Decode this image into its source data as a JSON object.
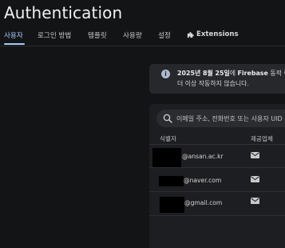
{
  "header": {
    "title": "Authentication"
  },
  "tabs": [
    {
      "label": "사용자",
      "active": true
    },
    {
      "label": "로그인 방법",
      "active": false
    },
    {
      "label": "템플릿",
      "active": false
    },
    {
      "label": "사용량",
      "active": false
    },
    {
      "label": "설정",
      "active": false
    },
    {
      "label": "Extensions",
      "active": false,
      "icon": "extension-icon"
    }
  ],
  "banner": {
    "icon": "info-icon",
    "line1_prefix": "2025년 8월 25일",
    "line1_mid": "에 ",
    "line1_product": "Firebase",
    "line1_suffix": " 동적 링크",
    "line2": "더 이상 작동하지 않습니다."
  },
  "search": {
    "icon": "search-icon",
    "placeholder": "이메일 주소, 전화번호 또는 사용자 UID"
  },
  "table": {
    "columns": [
      "식별자",
      "제공업체"
    ],
    "rows": [
      {
        "identifier": "@ansan.ac.kr",
        "provider_icon": "mail-icon"
      },
      {
        "identifier": "@naver.com",
        "provider_icon": "mail-icon"
      },
      {
        "identifier": "@gmail.com",
        "provider_icon": "mail-icon"
      }
    ]
  },
  "colors": {
    "background": "#131416",
    "accent": "#a8c7fa",
    "panel": "#1d1e21",
    "banner": "#26282c"
  }
}
